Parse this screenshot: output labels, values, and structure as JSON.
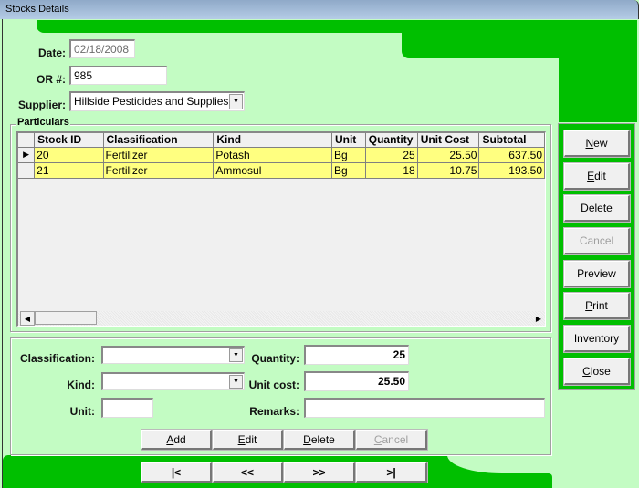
{
  "window": {
    "title": "Stocks Details"
  },
  "header": {
    "date_label": "Date:",
    "date_value": "02/18/2008",
    "or_label": "OR #:",
    "or_value": "985",
    "supplier_label": "Supplier:",
    "supplier_value": "Hillside Pesticides and Supplies"
  },
  "particulars": {
    "title": "Particulars",
    "columns": [
      "Stock  ID",
      "Classification",
      "Kind",
      "Unit",
      "Quantity",
      "Unit  Cost",
      "Subtotal"
    ],
    "rows": [
      {
        "selected": true,
        "stock_id": "20",
        "classification": "Fertilizer",
        "kind": "Potash",
        "unit": "Bg",
        "quantity": "25",
        "unit_cost": "25.50",
        "subtotal": "637.50"
      },
      {
        "selected": false,
        "stock_id": "21",
        "classification": "Fertilizer",
        "kind": "Ammosul",
        "unit": "Bg",
        "quantity": "18",
        "unit_cost": "10.75",
        "subtotal": "193.50"
      }
    ]
  },
  "detail_form": {
    "classification_label": "Classification:",
    "classification_value": "",
    "kind_label": "Kind:",
    "kind_value": "",
    "unit_label": "Unit:",
    "unit_value": "",
    "quantity_label": "Quantity:",
    "quantity_value": "25",
    "unit_cost_label": "Unit cost:",
    "unit_cost_value": "25.50",
    "remarks_label": "Remarks:",
    "remarks_value": ""
  },
  "detail_buttons": [
    {
      "label": "Add",
      "accel": "A",
      "rest": "dd",
      "enabled": true
    },
    {
      "label": "Edit",
      "accel": "E",
      "rest": "dit",
      "enabled": true
    },
    {
      "label": "Delete",
      "accel": "D",
      "rest": "elete",
      "enabled": true
    },
    {
      "label": "Cancel",
      "accel": "C",
      "rest": "ancel",
      "enabled": false
    }
  ],
  "nav_buttons": [
    {
      "label": "|<",
      "name": "first"
    },
    {
      "label": "<<",
      "name": "previous"
    },
    {
      "label": ">>",
      "name": "next"
    },
    {
      "label": ">|",
      "name": "last"
    }
  ],
  "side_buttons": [
    {
      "label": "New",
      "accel": "N",
      "rest": "ew",
      "enabled": true
    },
    {
      "label": "Edit",
      "accel": "E",
      "rest": "dit",
      "enabled": true
    },
    {
      "label": "Delete",
      "accel": "",
      "rest": "Delete",
      "enabled": true
    },
    {
      "label": "Cancel",
      "accel": "",
      "rest": "Cancel",
      "enabled": false
    },
    {
      "label": "Preview",
      "accel": "",
      "rest": "Preview",
      "enabled": true
    },
    {
      "label": "Print",
      "accel": "P",
      "rest": "rint",
      "enabled": true
    },
    {
      "label": "Inventory",
      "accel": "",
      "rest": "Inventory",
      "enabled": true
    },
    {
      "label": "Close",
      "accel": "C",
      "rest": "lose",
      "enabled": true
    }
  ],
  "icons": {
    "row_pointer": "▶",
    "dropdown": "▼",
    "scroll_left": "◀",
    "scroll_right": "▶"
  },
  "colors": {
    "background": "#c3fcc3",
    "accent_green": "#00bf00",
    "row_highlight": "#ffff80"
  }
}
